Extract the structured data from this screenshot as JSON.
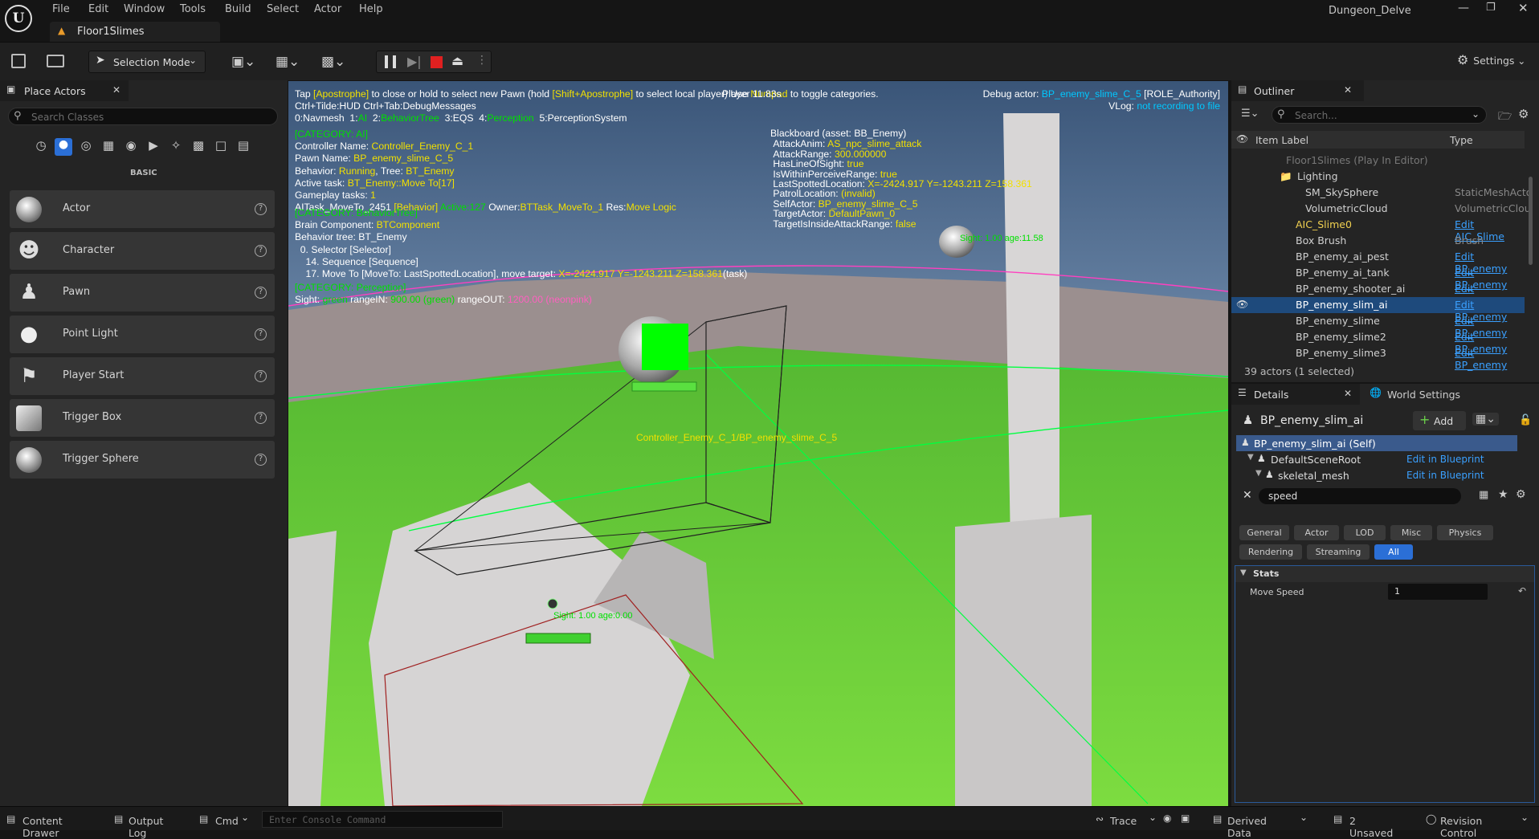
{
  "app": {
    "project": "Dungeon_Delve",
    "level_tab": "Floor1Slimes"
  },
  "menu": [
    "File",
    "Edit",
    "Window",
    "Tools",
    "Build",
    "Select",
    "Actor",
    "Help"
  ],
  "toolbar": {
    "mode": "Selection Mode",
    "settings": "Settings"
  },
  "place_actors": {
    "title": "Place Actors",
    "search_placeholder": "Search Classes",
    "category": "BASIC",
    "items": [
      "Actor",
      "Character",
      "Pawn",
      "Point Light",
      "Player Start",
      "Trigger Box",
      "Trigger Sphere"
    ]
  },
  "viewport": {
    "hint1a": "Tap ",
    "hint1b": "[Apostrophe]",
    "hint1c": " to close or hold to select new Pawn (hold ",
    "hint1d": "[Shift+Apostrophe]",
    "hint1e": " to select local player) Use ",
    "hint1f": "Numpad",
    "hint1g": " to toggle categories.",
    "fps": "Player 11.83s",
    "hint2": "Ctrl+Tilde:HUD  Ctrl+Tab:DebugMessages",
    "cats": [
      "0:Navmesh",
      "1:",
      "AI",
      "2:",
      "BehaviorTree",
      "3:EQS",
      "4:",
      "Perception",
      "5:PerceptionSystem"
    ],
    "debug_actor_label": "Debug actor: ",
    "debug_actor": "BP_enemy_slime_C_5",
    "role": " [ROLE_Authority]",
    "vlog_label": "VLog: ",
    "vlog": "not recording to file",
    "ai": {
      "header": "[CATEGORY: AI]",
      "lines": [
        [
          "Controller Name: ",
          "Controller_Enemy_C_1"
        ],
        [
          "Pawn Name: ",
          "BP_enemy_slime_C_5"
        ],
        [
          "Behavior: ",
          "Running",
          ", Tree: ",
          "BT_Enemy"
        ],
        [
          "Active task: ",
          "BT_Enemy::Move To[17]"
        ],
        [
          "Gameplay tasks: ",
          "1"
        ]
      ],
      "task_a": "  AITask_MoveTo_2451 ",
      "task_b": "[Behavior]",
      "task_c": " Active:127",
      "task_d": " Owner:",
      "task_e": "BTTask_MoveTo_1",
      "task_f": " Res:",
      "task_g": "Move Logic"
    },
    "bt": {
      "header": "[CATEGORY: BehaviorTree]",
      "brain_label": "Brain Component: ",
      "brain": "BTComponent",
      "tree": "Behavior tree: BT_Enemy",
      "n0": "  0. Selector [Selector]",
      "n14": "    14. Sequence [Sequence]",
      "n17a": "    17. Move To [MoveTo: LastSpottedLocation], move target: ",
      "n17b": "X=-2424.917 Y=-1243.211 Z=158.361",
      "n17c": "(task)"
    },
    "perc": {
      "header": "[CATEGORY: Perception]",
      "a": "Sight: ",
      "b": "green",
      "c": " rangeIN: ",
      "d": "900.00 (green)",
      "e": " rangeOUT: ",
      "f": "1200.00 (neonpink)"
    },
    "bb": {
      "header": "Blackboard (asset: BB_Enemy)",
      "rows": [
        [
          "AttackAnim: ",
          "AS_npc_slime_attack"
        ],
        [
          "AttackRange: ",
          "300.000000"
        ],
        [
          "HasLineOfSight: ",
          "true"
        ],
        [
          "IsWithinPerceiveRange: ",
          "true"
        ],
        [
          "LastSpottedLocation: ",
          "X=-2424.917 Y=-1243.211 Z=158.361"
        ],
        [
          "PatrolLocation: ",
          "(invalid)"
        ],
        [
          "SelfActor: ",
          "BP_enemy_slime_C_5"
        ],
        [
          "TargetActor: ",
          "DefaultPawn_0"
        ],
        [
          "TargetIsInsideAttackRange: ",
          "false"
        ]
      ]
    },
    "world_label": "Controller_Enemy_C_1/BP_enemy_slime_C_5",
    "sight1": "Sight: 1.00 age:11.58",
    "sight2": "Sight: 1.00 age:0.00"
  },
  "outliner": {
    "title": "Outliner",
    "search_placeholder": "Search...",
    "col_label": "Item Label",
    "col_type": "Type",
    "rows": [
      [
        "Floor1Slimes (Play In Editor)",
        ""
      ],
      [
        "Lighting",
        ""
      ],
      [
        "SM_SkySphere",
        "StaticMeshActo"
      ],
      [
        "VolumetricCloud",
        "VolumetricClou"
      ],
      [
        "AIC_Slime0",
        "Edit AIC_Slime"
      ],
      [
        "Box Brush",
        "Brush"
      ],
      [
        "BP_enemy_ai_pest",
        "Edit BP_enemy"
      ],
      [
        "BP_enemy_ai_tank",
        "Edit BP_enemy"
      ],
      [
        "BP_enemy_shooter_ai",
        "Edit BP_enemy"
      ],
      [
        "BP_enemy_slim_ai",
        "Edit BP_enemy"
      ],
      [
        "BP_enemy_slime",
        "Edit BP_enemy"
      ],
      [
        "BP_enemy_slime2",
        "Edit BP_enemy"
      ],
      [
        "BP_enemy_slime3",
        "Edit BP_enemy"
      ]
    ],
    "count": "39 actors (1 selected)"
  },
  "details": {
    "tab": "Details",
    "tab2": "World Settings",
    "actor": "BP_enemy_slim_ai",
    "add": "Add",
    "tree": [
      [
        "BP_enemy_slim_ai (Self)",
        ""
      ],
      [
        "DefaultSceneRoot",
        "Edit in Blueprint"
      ],
      [
        "skeletal_mesh",
        "Edit in Blueprint"
      ]
    ],
    "search": "speed",
    "filters1": [
      "General",
      "Actor",
      "LOD",
      "Misc",
      "Physics"
    ],
    "filters2": [
      "Rendering",
      "Streaming",
      "All"
    ],
    "section": "Stats",
    "prop_label": "Move Speed",
    "prop_value": "1"
  },
  "status": {
    "content_drawer": "Content Drawer",
    "output_log": "Output Log",
    "cmd": "Cmd",
    "console_placeholder": "Enter Console Command",
    "trace": "Trace",
    "derived": "Derived Data",
    "unsaved": "2 Unsaved",
    "revision": "Revision Control"
  }
}
